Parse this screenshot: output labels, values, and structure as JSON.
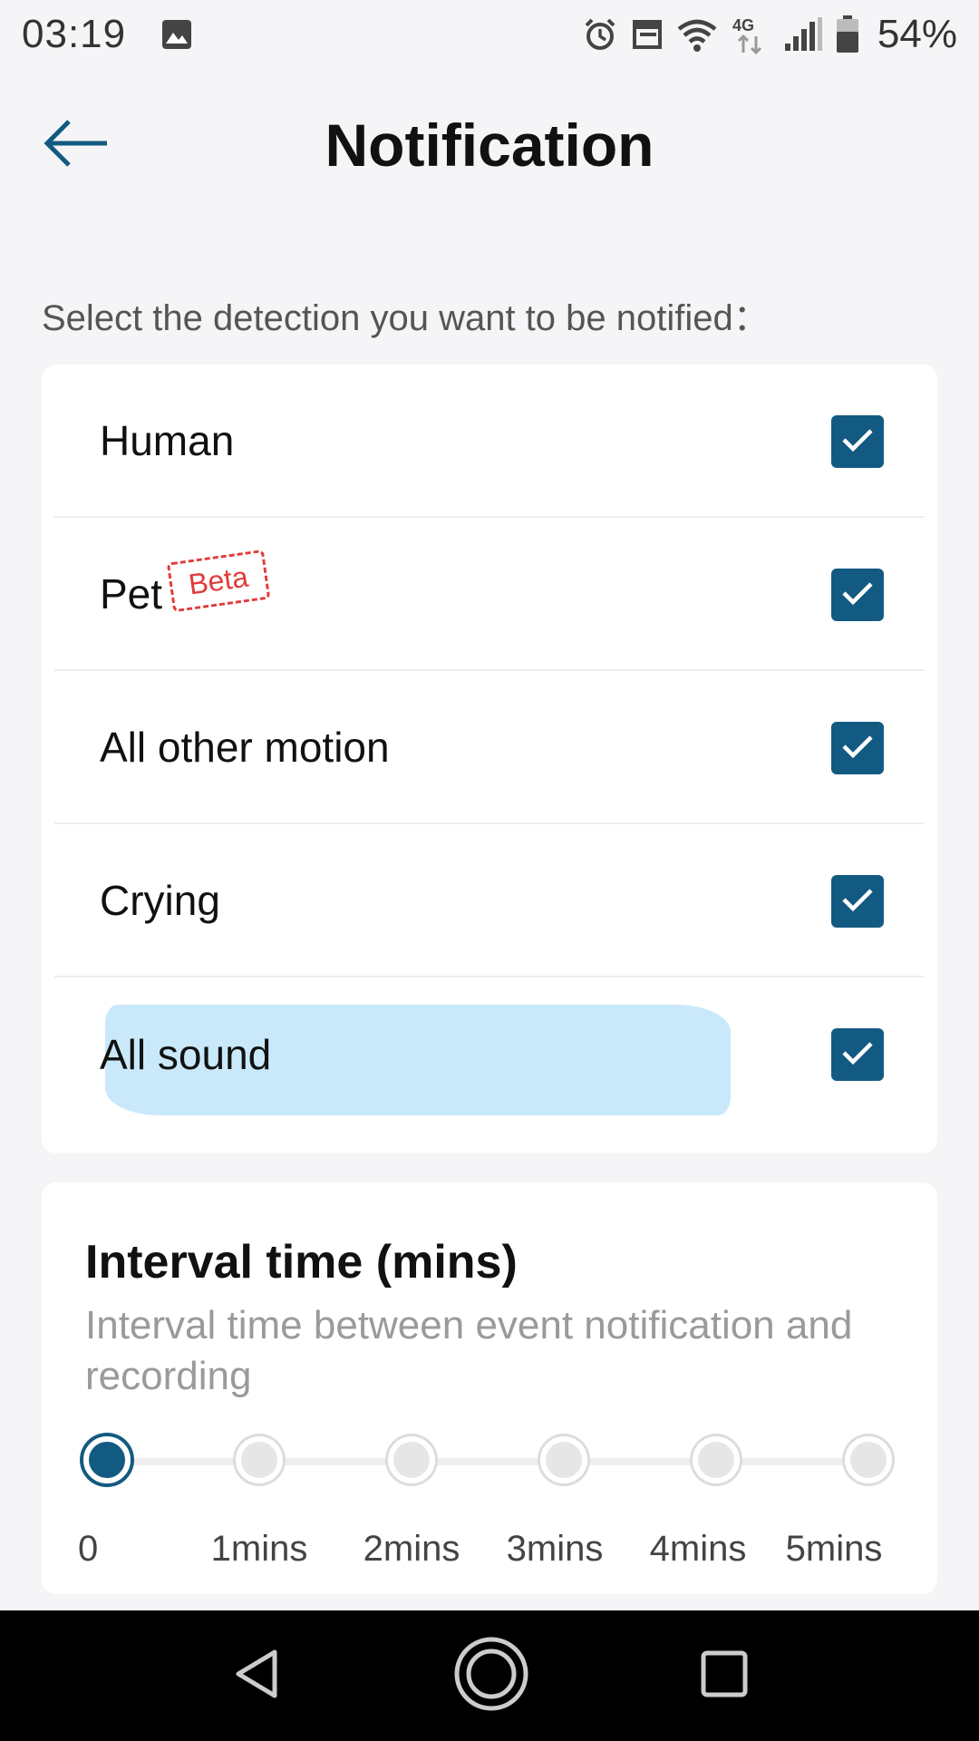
{
  "status_bar": {
    "time": "03:19",
    "battery": "54%",
    "network": "4G",
    "icons": [
      "image-icon",
      "alarm-icon",
      "cast-icon",
      "wifi-icon",
      "data-arrows-icon",
      "signal-icon",
      "battery-icon"
    ]
  },
  "header": {
    "title": "Notification",
    "back_icon": "arrow-left-icon"
  },
  "prompt": "Select the detection you want to be notified：",
  "detections": [
    {
      "label": "Human",
      "checked": true
    },
    {
      "label": "Pet",
      "checked": true,
      "badge": "Beta"
    },
    {
      "label": "All other motion",
      "checked": true
    },
    {
      "label": "Crying",
      "checked": true
    },
    {
      "label": "All sound",
      "checked": true
    }
  ],
  "interval": {
    "title": "Interval time (mins)",
    "subtitle": "Interval time between event notification and recording",
    "options": [
      "0",
      "1mins",
      "2mins",
      "3mins",
      "4mins",
      "5mins"
    ],
    "selected": "0"
  },
  "nav": {
    "back": "nav-back-icon",
    "home": "nav-home-icon",
    "recents": "nav-recents-icon"
  },
  "colors": {
    "accent": "#135a82",
    "beta": "#e23b3b",
    "highlight": "#c9e9fb"
  }
}
